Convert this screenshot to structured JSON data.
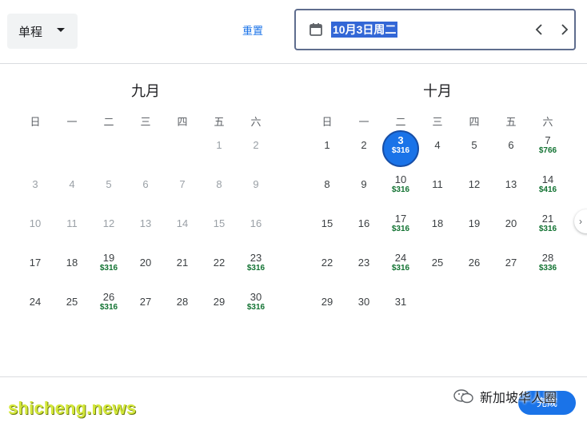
{
  "header": {
    "trip_type": "单程",
    "reset_label": "重置",
    "date_value": "10月3日周二"
  },
  "weekdays": [
    "日",
    "一",
    "二",
    "三",
    "四",
    "五",
    "六"
  ],
  "months": [
    {
      "title": "九月",
      "first_weekday": 5,
      "days": [
        {
          "d": "1",
          "dim": true
        },
        {
          "d": "2",
          "dim": true
        },
        {
          "d": "3",
          "dim": true
        },
        {
          "d": "4",
          "dim": true
        },
        {
          "d": "5",
          "dim": true
        },
        {
          "d": "6",
          "dim": true
        },
        {
          "d": "7",
          "dim": true
        },
        {
          "d": "8",
          "dim": true
        },
        {
          "d": "9",
          "dim": true
        },
        {
          "d": "10",
          "dim": true
        },
        {
          "d": "11",
          "dim": true
        },
        {
          "d": "12",
          "dim": true
        },
        {
          "d": "13",
          "dim": true
        },
        {
          "d": "14",
          "dim": true
        },
        {
          "d": "15",
          "dim": true
        },
        {
          "d": "16",
          "dim": true
        },
        {
          "d": "17"
        },
        {
          "d": "18"
        },
        {
          "d": "19",
          "price": "$316"
        },
        {
          "d": "20"
        },
        {
          "d": "21"
        },
        {
          "d": "22"
        },
        {
          "d": "23",
          "price": "$316"
        },
        {
          "d": "24"
        },
        {
          "d": "25"
        },
        {
          "d": "26",
          "price": "$316"
        },
        {
          "d": "27"
        },
        {
          "d": "28"
        },
        {
          "d": "29"
        },
        {
          "d": "30",
          "price": "$316"
        }
      ]
    },
    {
      "title": "十月",
      "first_weekday": 0,
      "days": [
        {
          "d": "1"
        },
        {
          "d": "2"
        },
        {
          "d": "3",
          "price": "$316",
          "selected": true
        },
        {
          "d": "4"
        },
        {
          "d": "5"
        },
        {
          "d": "6"
        },
        {
          "d": "7",
          "price": "$766"
        },
        {
          "d": "8"
        },
        {
          "d": "9"
        },
        {
          "d": "10",
          "price": "$316"
        },
        {
          "d": "11"
        },
        {
          "d": "12"
        },
        {
          "d": "13"
        },
        {
          "d": "14",
          "price": "$416"
        },
        {
          "d": "15"
        },
        {
          "d": "16"
        },
        {
          "d": "17",
          "price": "$316"
        },
        {
          "d": "18"
        },
        {
          "d": "19"
        },
        {
          "d": "20"
        },
        {
          "d": "21",
          "price": "$316"
        },
        {
          "d": "22"
        },
        {
          "d": "23"
        },
        {
          "d": "24",
          "price": "$316"
        },
        {
          "d": "25"
        },
        {
          "d": "26"
        },
        {
          "d": "27"
        },
        {
          "d": "28",
          "price": "$336"
        },
        {
          "d": "29"
        },
        {
          "d": "30"
        },
        {
          "d": "31"
        }
      ]
    }
  ],
  "footer": {
    "done_label": "完成"
  },
  "watermarks": {
    "left": "shicheng.news",
    "right": "新加坡华人圈"
  },
  "colors": {
    "accent": "#1a73e8",
    "price": "#137333",
    "selection": "#3367d6"
  }
}
